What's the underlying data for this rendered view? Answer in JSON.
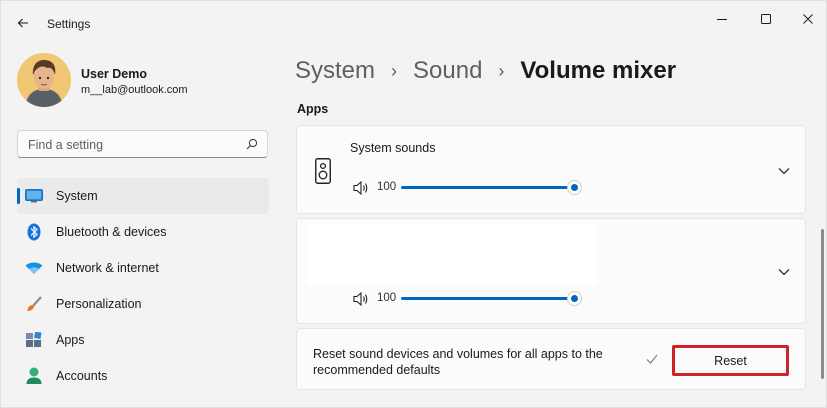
{
  "window": {
    "title": "Settings"
  },
  "user": {
    "name": "User Demo",
    "email": "m__lab@outlook.com"
  },
  "search": {
    "placeholder": "Find a setting"
  },
  "sidebar": {
    "items": [
      {
        "label": "System",
        "icon": "monitor-icon",
        "selected": true
      },
      {
        "label": "Bluetooth & devices",
        "icon": "bluetooth-icon"
      },
      {
        "label": "Network & internet",
        "icon": "wifi-icon"
      },
      {
        "label": "Personalization",
        "icon": "paintbrush-icon"
      },
      {
        "label": "Apps",
        "icon": "apps-icon"
      },
      {
        "label": "Accounts",
        "icon": "person-icon"
      }
    ]
  },
  "breadcrumb": {
    "items": [
      "System",
      "Sound",
      "Volume mixer"
    ]
  },
  "main": {
    "section_title": "Apps",
    "apps": [
      {
        "name": "System sounds",
        "volume": "100",
        "icon": "speaker-icon",
        "level_fraction": 1.0
      },
      {
        "name": "",
        "volume": "100",
        "level_fraction": 1.0
      }
    ],
    "reset": {
      "text": "Reset sound devices and volumes for all apps to the recommended defaults",
      "button_label": "Reset"
    }
  },
  "colors": {
    "accent": "#0067c0",
    "highlight_border": "#d0202a",
    "background": "#f3f3f3"
  }
}
